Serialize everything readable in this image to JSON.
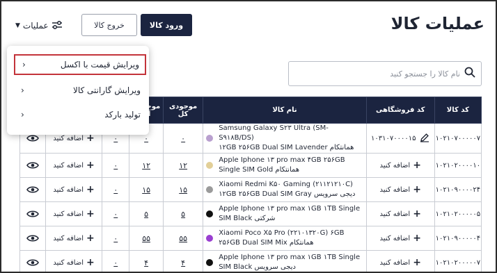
{
  "header": {
    "title": "عملیات کالا",
    "enter_button": "ورود کالا",
    "exit_button": "خروج کالا",
    "operations_button": "عملیات"
  },
  "search": {
    "placeholder": "نام کالا را جستجو کنید"
  },
  "dropdown": {
    "items": [
      {
        "label": "ویرایش قیمت با اکسل",
        "arrow": "›"
      },
      {
        "label": "ویرایش گارانتی کالا",
        "arrow": "›"
      },
      {
        "label": "تولید بارکد",
        "arrow": "›"
      }
    ]
  },
  "table": {
    "headers": {
      "code": "کد کالا",
      "seller_code": "کد فروشگاهی",
      "name": "نام کالا",
      "total_stock_1": "موجودی",
      "total_stock_2": "کل",
      "free_stock_1": "موجودی",
      "free_stock_2": "آزا"
    },
    "add_label": "اضافه کنید",
    "rows": [
      {
        "code": "۱۰۲۱۰۷۰۰۰۰۰۷",
        "seller_code": "۱۰۳۱۰۷۰۰۰۰۱۵",
        "name1": "Samsung Galaxy S۲۳ Ultra (SM-S۹۱۸B/DS)",
        "name2": "۱۲GB ۲۵۶GB Dual SIM Lavender همانتکام",
        "color": "#b9a0cf",
        "total": "۰",
        "free": "۰",
        "c1": "۰"
      },
      {
        "code": "۱۰۲۱۰۲۰۰۰۰۱۰",
        "seller_code": "",
        "name1": "Apple Iphone ۱۳ pro max ۴GB ۲۵۶GB",
        "name2": "Single SIM Gold همانتکام",
        "color": "#e2cf98",
        "total": "۱۲",
        "free": "۱۲",
        "c1": "۰"
      },
      {
        "code": "۱۰۲۱۰۹۰۰۰۰۲۴",
        "seller_code": "",
        "name1": "Xiaomi Redmi K۵۰ Gaming (۲۱۱۲۱۲۱۰C)",
        "name2": "۱۲GB ۲۵۶GB Dual SIM Gray دیجی سرویس",
        "color": "#9b9b9b",
        "total": "۱۵",
        "free": "۱۵",
        "c1": "۰"
      },
      {
        "code": "۱۰۲۱۰۲۰۰۰۰۰۵",
        "seller_code": "",
        "name1": "Apple Iphone ۱۳ pro max ۱GB ۱TB Single",
        "name2": "SIM Black شرکتی",
        "color": "#111111",
        "total": "۵",
        "free": "۵",
        "c1": "۰"
      },
      {
        "code": "۱۰۲۱۰۹۰۰۰۰۰۴",
        "seller_code": "",
        "name1": "Xiaomi Poco X۵ Pro (۲۲۱۰۱۳۲۰G) ۶GB",
        "name2": "۲۵۶GB Dual SIM Mix همانتکام",
        "color": "#9a3fd1",
        "total": "۵۵",
        "free": "۵۵",
        "c1": "۰"
      },
      {
        "code": "۱۰۲۱۰۲۰۰۰۰۰۷",
        "seller_code": "",
        "name1": "Apple Iphone ۱۳ pro max ۱GB ۱TB Single",
        "name2": "SIM Black دیجی سرویس",
        "color": "#111111",
        "total": "۴",
        "free": "۴",
        "c1": "۰"
      }
    ]
  }
}
